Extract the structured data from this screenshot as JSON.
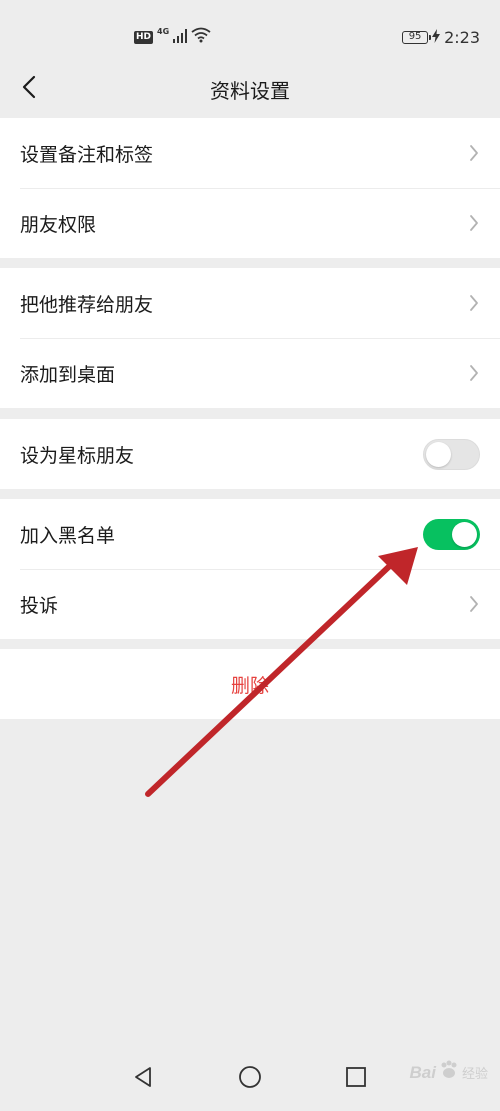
{
  "status_bar": {
    "hd_badge": "HD",
    "network": "4G",
    "battery": "95",
    "time": "2:23"
  },
  "nav": {
    "title": "资料设置"
  },
  "groups": {
    "remark": {
      "items": [
        {
          "label": "设置备注和标签"
        },
        {
          "label": "朋友权限"
        }
      ]
    },
    "share": {
      "items": [
        {
          "label": "把他推荐给朋友"
        },
        {
          "label": "添加到桌面"
        }
      ]
    },
    "star": {
      "label": "设为星标朋友",
      "enabled": false
    },
    "blacklist": {
      "label": "加入黑名单",
      "enabled": true
    },
    "complain": {
      "label": "投诉"
    },
    "delete": {
      "label": "删除"
    }
  },
  "watermark": {
    "brand": "Bai",
    "suffix": "经验"
  },
  "colors": {
    "toggle_on": "#07c160",
    "delete_red": "#e64340",
    "background": "#ededed",
    "annotation_arrow": "#c0262a"
  },
  "icons": {
    "back": "chevron-left-icon",
    "row_arrow": "chevron-right-icon",
    "wifi": "wifi-icon",
    "signal": "signal-icon",
    "charging": "charging-bolt-icon",
    "nav_back": "triangle-back-icon",
    "nav_home": "circle-home-icon",
    "nav_recent": "square-recent-icon",
    "watermark": "paw-logo-icon"
  }
}
